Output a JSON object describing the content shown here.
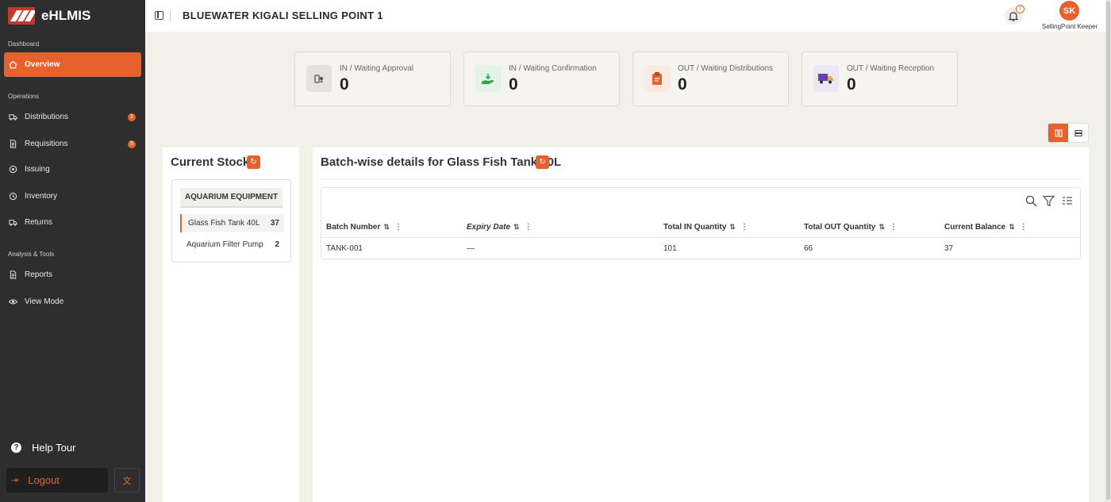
{
  "app": {
    "name": "eHLMIS"
  },
  "header": {
    "title": "BLUEWATER KIGALI SELLING POINT 1",
    "notifications_count": "7",
    "user_initials": "SK",
    "user_role": "SellingPoint Keeper"
  },
  "sidebar": {
    "sections": [
      "Dashboard",
      "Operations",
      "Analysis & Tools"
    ],
    "items": [
      {
        "label": "Overview",
        "icon": "home-icon",
        "active": true
      },
      {
        "label": "Distributions",
        "icon": "truck-icon",
        "badge": "2"
      },
      {
        "label": "Requisitions",
        "icon": "document-icon",
        "badge": "5"
      },
      {
        "label": "Issuing",
        "icon": "issue-icon"
      },
      {
        "label": "Inventory",
        "icon": "inventory-icon"
      },
      {
        "label": "Returns",
        "icon": "returns-icon"
      },
      {
        "label": "Reports",
        "icon": "reports-icon"
      },
      {
        "label": "View Mode",
        "icon": "eye-icon"
      }
    ],
    "help_label": "Help Tour",
    "logout_label": "Logout"
  },
  "stats": [
    {
      "label": "IN / Waiting Approval",
      "value": "0",
      "icon": "approval-icon",
      "color": "#e4e4dc"
    },
    {
      "label": "IN / Waiting Confirmation",
      "value": "0",
      "icon": "confirm-hand-icon",
      "color": "#e3f4e6"
    },
    {
      "label": "OUT / Waiting Distributions",
      "value": "0",
      "icon": "clipboard-icon",
      "color": "#fbeadf"
    },
    {
      "label": "OUT / Waiting Reception",
      "value": "0",
      "icon": "delivery-truck-icon",
      "color": "#ece7f5"
    }
  ],
  "stock": {
    "title": "Current Stock",
    "category": "AQUARIUM EQUIPMENT",
    "items": [
      {
        "name": "Glass Fish Tank 40L",
        "qty": "37",
        "selected": true
      },
      {
        "name": "Aquarium Filter Pump",
        "qty": "2"
      }
    ]
  },
  "batch": {
    "title": "Batch-wise details for Glass Fish Tank 40L",
    "columns": [
      "Batch Number",
      "Expiry Date",
      "Total IN Quantity",
      "Total OUT Quantity",
      "Current Balance"
    ],
    "rows": [
      [
        "TANK-001",
        "—",
        "101",
        "66",
        "37"
      ]
    ]
  },
  "colors": {
    "accent": "#e8612c",
    "sidebar": "#2e2e2e",
    "background": "#f1f0e9"
  }
}
